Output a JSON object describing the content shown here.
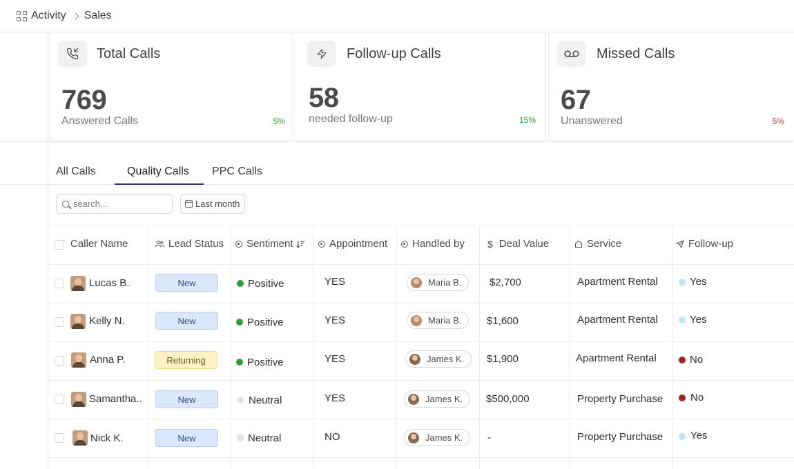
{
  "breadcrumb": {
    "root": "Activity",
    "current": "Sales"
  },
  "cards": [
    {
      "title": "Total Calls",
      "value": "769",
      "sub": "Answered Calls",
      "pct": "5%",
      "pct_color": "#2e9e3a",
      "icon": "phone-incoming-icon"
    },
    {
      "title": "Follow-up Calls",
      "value": "58",
      "sub": "needed follow-up",
      "pct": "15%",
      "pct_color": "#2e9e3a",
      "icon": "lightning-icon"
    },
    {
      "title": "Missed Calls",
      "value": "67",
      "sub": "Unanswered",
      "pct": "5%",
      "pct_color": "#a33030",
      "icon": "voicemail-icon"
    }
  ],
  "tabs": [
    "All Calls",
    "Quality Calls",
    "PPC Calls"
  ],
  "active_tab": "Quality Calls",
  "filters": {
    "search_placeholder": "search...",
    "date_label": "Last month"
  },
  "columns": [
    "Caller Name",
    "Lead Status",
    "Sentiment",
    "Appointment",
    "Handled by",
    "Deal Value",
    "Service",
    "Follow-up"
  ],
  "rows": [
    {
      "name": "Lucas B.",
      "status": "New",
      "sentiment": "Positive",
      "appointment": "YES",
      "handler": "Maria B.",
      "deal": "$2,700",
      "service": "Apartment Rental",
      "followup": "Yes"
    },
    {
      "name": "Kelly N.",
      "status": "New",
      "sentiment": "Positive",
      "appointment": "YES",
      "handler": "Maria B.",
      "deal": "$1,600",
      "service": "Apartment Rental",
      "followup": "Yes"
    },
    {
      "name": "Anna P.",
      "status": "Returning",
      "sentiment": "Positive",
      "appointment": "YES",
      "handler": "James K.",
      "deal": "$1,900",
      "service": "Apartment Rental",
      "followup": "No"
    },
    {
      "name": "Samantha..",
      "status": "New",
      "sentiment": "Neutral",
      "appointment": "YES",
      "handler": "James K.",
      "deal": "$500,000",
      "service": "Property Purchase",
      "followup": "No"
    },
    {
      "name": "Nick K.",
      "status": "New",
      "sentiment": "Neutral",
      "appointment": "NO",
      "handler": "James K.",
      "deal": "-",
      "service": "Property Purchase",
      "followup": "Yes"
    }
  ],
  "colors": {
    "positive": "#2e9e3a",
    "neutral": "#e2e2e5",
    "followup_yes": "#bfe6f8",
    "followup_no": "#9e2424",
    "tab_accent": "#3b2a7a"
  }
}
